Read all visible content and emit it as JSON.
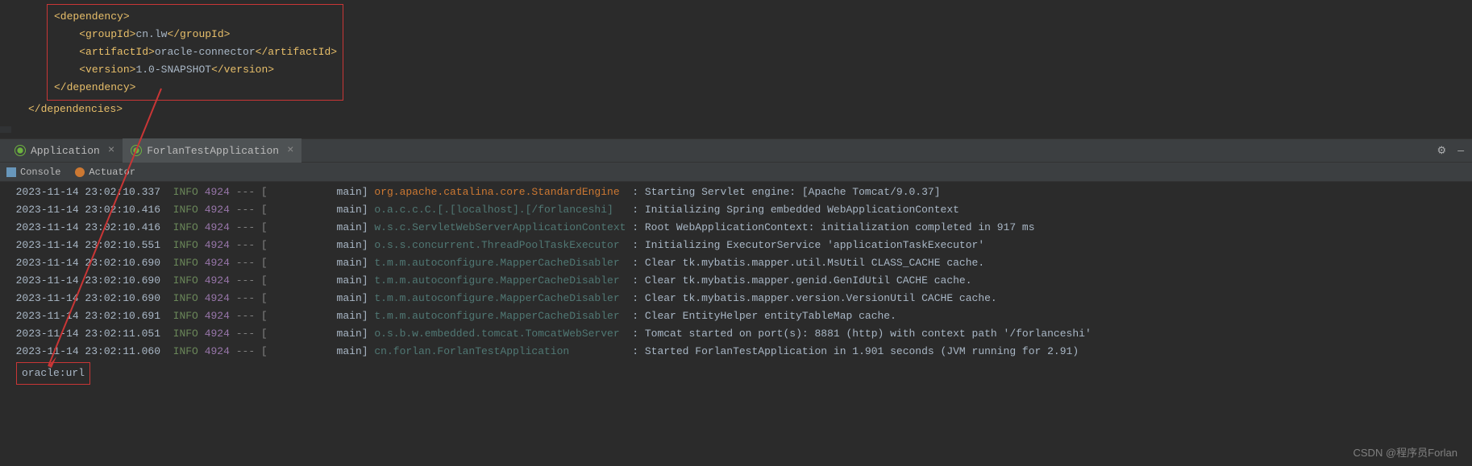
{
  "code": {
    "dep_open": "<dependency>",
    "group_open": "<groupId>",
    "group_val": "cn.lw",
    "group_close": "</groupId>",
    "artifact_open": "<artifactId>",
    "artifact_val": "oracle-connector",
    "artifact_close": "</artifactId>",
    "version_open": "<version>",
    "version_val": "1.0-SNAPSHOT",
    "version_close": "</version>",
    "dep_close": "</dependency>",
    "deps_close": "</dependencies>"
  },
  "tabs": {
    "app": "Application",
    "forlan": "ForlanTestApplication"
  },
  "subtabs": {
    "console": "Console",
    "actuator": "Actuator"
  },
  "logs": [
    {
      "ts": "2023-11-14 23:02:10.337",
      "lvl": "INFO",
      "pid": "4924",
      "sep": "--- [",
      "th": "           main]",
      "logger": "org.apache.catalina.core.StandardEngine ",
      "msg": ": Starting Servlet engine: [Apache Tomcat/9.0.37]"
    },
    {
      "ts": "2023-11-14 23:02:10.416",
      "lvl": "INFO",
      "pid": "4924",
      "sep": "--- [",
      "th": "           main]",
      "logger": "o.a.c.c.C.[.[localhost].[/forlanceshi]  ",
      "msg": ": Initializing Spring embedded WebApplicationContext"
    },
    {
      "ts": "2023-11-14 23:02:10.416",
      "lvl": "INFO",
      "pid": "4924",
      "sep": "--- [",
      "th": "           main]",
      "logger": "w.s.c.ServletWebServerApplicationContext",
      "msg": ": Root WebApplicationContext: initialization completed in 917 ms"
    },
    {
      "ts": "2023-11-14 23:02:10.551",
      "lvl": "INFO",
      "pid": "4924",
      "sep": "--- [",
      "th": "           main]",
      "logger": "o.s.s.concurrent.ThreadPoolTaskExecutor ",
      "msg": ": Initializing ExecutorService 'applicationTaskExecutor'"
    },
    {
      "ts": "2023-11-14 23:02:10.690",
      "lvl": "INFO",
      "pid": "4924",
      "sep": "--- [",
      "th": "           main]",
      "logger": "t.m.m.autoconfigure.MapperCacheDisabler ",
      "msg": ": Clear tk.mybatis.mapper.util.MsUtil CLASS_CACHE cache."
    },
    {
      "ts": "2023-11-14 23:02:10.690",
      "lvl": "INFO",
      "pid": "4924",
      "sep": "--- [",
      "th": "           main]",
      "logger": "t.m.m.autoconfigure.MapperCacheDisabler ",
      "msg": ": Clear tk.mybatis.mapper.genid.GenIdUtil CACHE cache."
    },
    {
      "ts": "2023-11-14 23:02:10.690",
      "lvl": "INFO",
      "pid": "4924",
      "sep": "--- [",
      "th": "           main]",
      "logger": "t.m.m.autoconfigure.MapperCacheDisabler ",
      "msg": ": Clear tk.mybatis.mapper.version.VersionUtil CACHE cache."
    },
    {
      "ts": "2023-11-14 23:02:10.691",
      "lvl": "INFO",
      "pid": "4924",
      "sep": "--- [",
      "th": "           main]",
      "logger": "t.m.m.autoconfigure.MapperCacheDisabler ",
      "msg": ": Clear EntityHelper entityTableMap cache."
    },
    {
      "ts": "2023-11-14 23:02:11.051",
      "lvl": "INFO",
      "pid": "4924",
      "sep": "--- [",
      "th": "           main]",
      "logger": "o.s.b.w.embedded.tomcat.TomcatWebServer ",
      "msg": ": Tomcat started on port(s): 8881 (http) with context path '/forlanceshi'"
    },
    {
      "ts": "2023-11-14 23:02:11.060",
      "lvl": "INFO",
      "pid": "4924",
      "sep": "--- [",
      "th": "           main]",
      "logger": "cn.forlan.ForlanTestApplication         ",
      "msg": ": Started ForlanTestApplication in 1.901 seconds (JVM running for 2.91)"
    }
  ],
  "output": "oracle:url",
  "watermark": "CSDN @程序员Forlan"
}
